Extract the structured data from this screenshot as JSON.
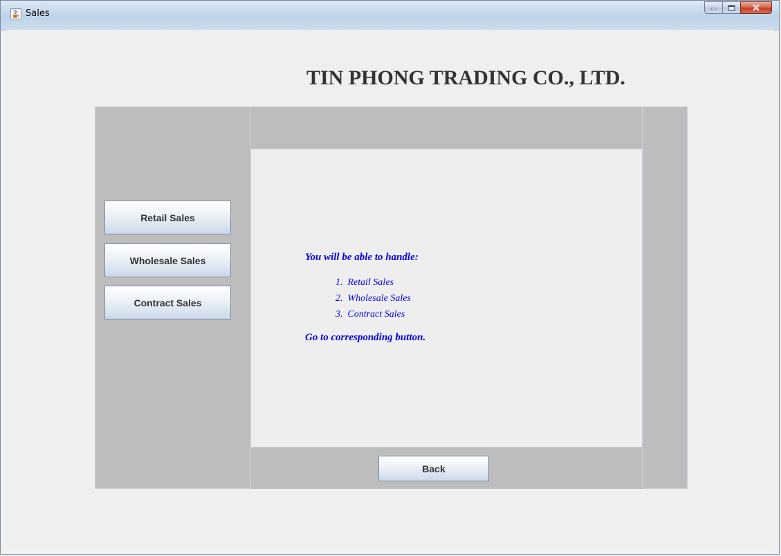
{
  "window": {
    "title": "Sales",
    "icon": "java-cup-icon",
    "controls": [
      "minimize-icon",
      "maximize-icon",
      "close-icon"
    ]
  },
  "header": {
    "company_name": "TIN PHONG TRADING CO., LTD."
  },
  "sidebar": {
    "buttons": [
      {
        "label": "Retail Sales"
      },
      {
        "label": "Wholesale Sales"
      },
      {
        "label": "Contract Sales"
      }
    ]
  },
  "info": {
    "heading": "You will be able to handle:",
    "items": [
      {
        "num": "1.",
        "text": "Retail Sales"
      },
      {
        "num": "2.",
        "text": "Wholesale Sales"
      },
      {
        "num": "3.",
        "text": "Contract Sales"
      }
    ],
    "footer": "Go to corresponding button.",
    "text_color": "#0000ee"
  },
  "footer_bar": {
    "back_label": "Back"
  },
  "colors": {
    "panel_gray": "#bdbdbd",
    "content_bg": "#eeeeee",
    "titlebar": "#c5d7ea"
  }
}
